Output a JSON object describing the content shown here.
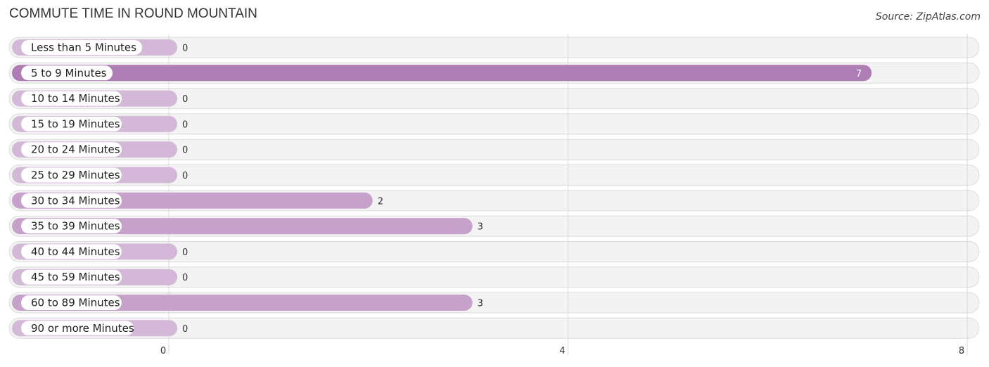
{
  "chart_data": {
    "type": "bar",
    "orientation": "horizontal",
    "title": "COMMUTE TIME IN ROUND MOUNTAIN",
    "source": "Source: ZipAtlas.com",
    "categories": [
      "Less than 5 Minutes",
      "5 to 9 Minutes",
      "10 to 14 Minutes",
      "15 to 19 Minutes",
      "20 to 24 Minutes",
      "25 to 29 Minutes",
      "30 to 34 Minutes",
      "35 to 39 Minutes",
      "40 to 44 Minutes",
      "45 to 59 Minutes",
      "60 to 89 Minutes",
      "90 or more Minutes"
    ],
    "values": [
      0,
      7,
      0,
      0,
      0,
      0,
      2,
      3,
      0,
      0,
      3,
      0
    ],
    "xlim": [
      0,
      8
    ],
    "xticks": [
      "0",
      "4",
      "8"
    ],
    "xlabel": "",
    "ylabel": "",
    "grid": true,
    "colors": {
      "max_bar": "#ad7db3",
      "bar": "#c6a2cb",
      "zero_bar": "#d4b8d8"
    }
  }
}
